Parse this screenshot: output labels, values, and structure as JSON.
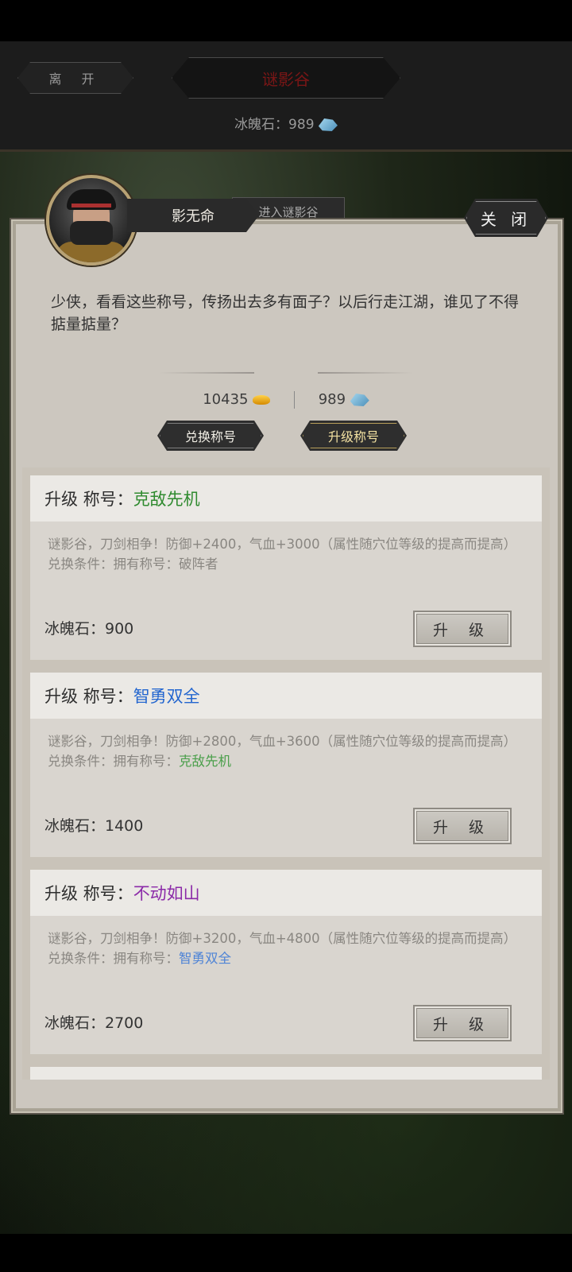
{
  "topbar": {
    "leave_label": "离 开",
    "location": "谜影谷",
    "currency_label": "冰魄石：989",
    "currency_icon": "ice-stone-icon"
  },
  "background_button": "进入谜影谷",
  "npc": {
    "name": "影无命"
  },
  "close_label": "关 闭",
  "intro": "少侠，看看这些称号，传扬出去多有面子？以后行走江湖，谁见了不得掂量掂量？",
  "currencies": {
    "gold": "10435",
    "ice": "989"
  },
  "tabs": {
    "exchange": "兑换称号",
    "upgrade": "升级称号"
  },
  "cards": [
    {
      "prefix": "升级 称号：",
      "title": "克敌先机",
      "title_color": "#2f8a2f",
      "desc": "谜影谷，刀剑相争！防御+2400，气血+3000（属性随穴位等级的提高而提高）",
      "cond_label": "兑换条件：拥有称号：",
      "cond_value": "破阵者",
      "cost": "冰魄石：900",
      "button": "升 级"
    },
    {
      "prefix": "升级 称号：",
      "title": "智勇双全",
      "title_color": "#2366cf",
      "desc": "谜影谷，刀剑相争！防御+2800，气血+3600（属性随穴位等级的提高而提高）",
      "cond_label": "兑换条件：拥有称号：",
      "cond_value": "克敌先机",
      "cost": "冰魄石：1400",
      "button": "升 级"
    },
    {
      "prefix": "升级 称号：",
      "title": "不动如山",
      "title_color": "#8b2aa8",
      "desc": "谜影谷，刀剑相争！防御+3200，气血+4800（属性随穴位等级的提高而提高）",
      "cond_label": "兑换条件：拥有称号：",
      "cond_value": "智勇双全",
      "cost": "冰魄石：2700",
      "button": "升 级"
    }
  ]
}
